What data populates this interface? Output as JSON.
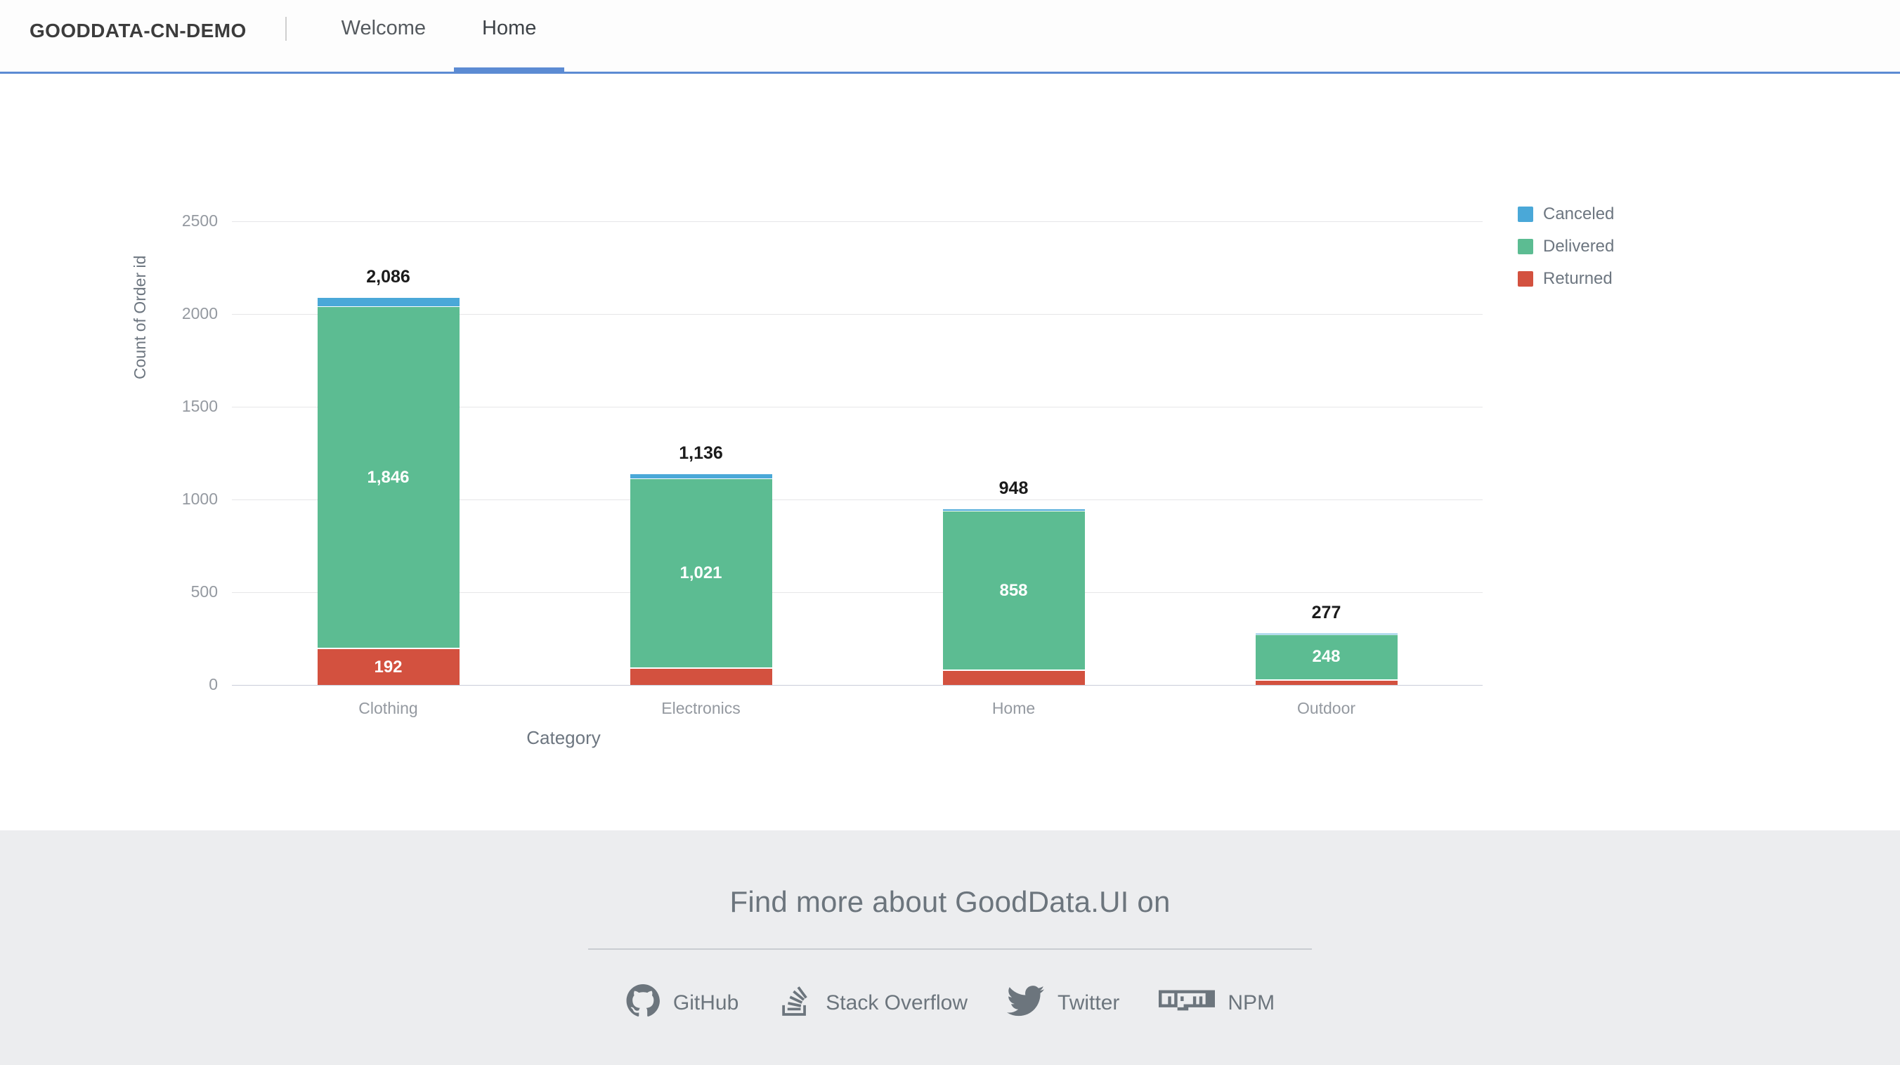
{
  "header": {
    "brand": "GOODDATA-CN-DEMO",
    "divider": "|",
    "tabs": [
      {
        "label": "Welcome",
        "active": false
      },
      {
        "label": "Home",
        "active": true
      }
    ]
  },
  "chart_data": {
    "type": "bar",
    "stacked": true,
    "title": "",
    "xlabel": "Category",
    "ylabel": "Count of Order id",
    "categories": [
      "Clothing",
      "Electronics",
      "Home",
      "Outdoor"
    ],
    "yticks": [
      0,
      500,
      1000,
      1500,
      2000,
      2500
    ],
    "ylim": [
      0,
      2500
    ],
    "grid": true,
    "legend_position": "right",
    "series": [
      {
        "name": "Returned",
        "color": "#d3513f",
        "values": [
          192,
          88,
          76,
          22
        ]
      },
      {
        "name": "Delivered",
        "color": "#5cbc92",
        "values": [
          1846,
          1021,
          858,
          248
        ]
      },
      {
        "name": "Canceled",
        "color": "#4aa8d8",
        "values": [
          48,
          27,
          14,
          7
        ]
      }
    ],
    "totals": [
      2086,
      1136,
      948,
      277
    ],
    "total_labels": [
      "2,086",
      "1,136",
      "948",
      "277"
    ],
    "visible_segment_labels": {
      "Clothing": {
        "Returned": "192",
        "Delivered": "1,846",
        "Canceled": ""
      },
      "Electronics": {
        "Returned": "",
        "Delivered": "1,021",
        "Canceled": ""
      },
      "Home": {
        "Returned": "",
        "Delivered": "858",
        "Canceled": ""
      },
      "Outdoor": {
        "Returned": "",
        "Delivered": "248",
        "Canceled": ""
      }
    },
    "legend": [
      {
        "label": "Canceled",
        "color": "#4aa8d8"
      },
      {
        "label": "Delivered",
        "color": "#5cbc92"
      },
      {
        "label": "Returned",
        "color": "#d3513f"
      }
    ]
  },
  "footer": {
    "title": "Find more about GoodData.UI on",
    "links": [
      {
        "label": "GitHub",
        "icon": "github-icon"
      },
      {
        "label": "Stack Overflow",
        "icon": "stack-overflow-icon"
      },
      {
        "label": "Twitter",
        "icon": "twitter-icon"
      },
      {
        "label": "NPM",
        "icon": "npm-icon"
      }
    ]
  }
}
